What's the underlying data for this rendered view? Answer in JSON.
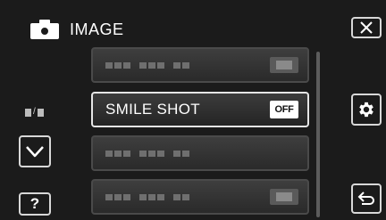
{
  "header": {
    "title": "IMAGE",
    "icon": "camera-icon"
  },
  "menu": {
    "items": [
      {
        "label": "",
        "value": "",
        "placeholder": true
      },
      {
        "label": "SMILE SHOT",
        "value": "OFF",
        "placeholder": false,
        "selected": true
      },
      {
        "label": "",
        "value": "",
        "placeholder": true
      },
      {
        "label": "",
        "value": "",
        "placeholder": true
      }
    ]
  },
  "page_indicator": {
    "separator": "/"
  },
  "buttons": {
    "close": {
      "icon": "close-icon"
    },
    "settings": {
      "icon": "gear-icon"
    },
    "down": {
      "icon": "chevron-down-icon"
    },
    "help": {
      "label": "?"
    },
    "back": {
      "icon": "return-arrow-icon"
    }
  },
  "colors": {
    "background": "#1b1b1b",
    "item_border_active": "#e6e6e6",
    "badge_bg": "#ffffff"
  }
}
